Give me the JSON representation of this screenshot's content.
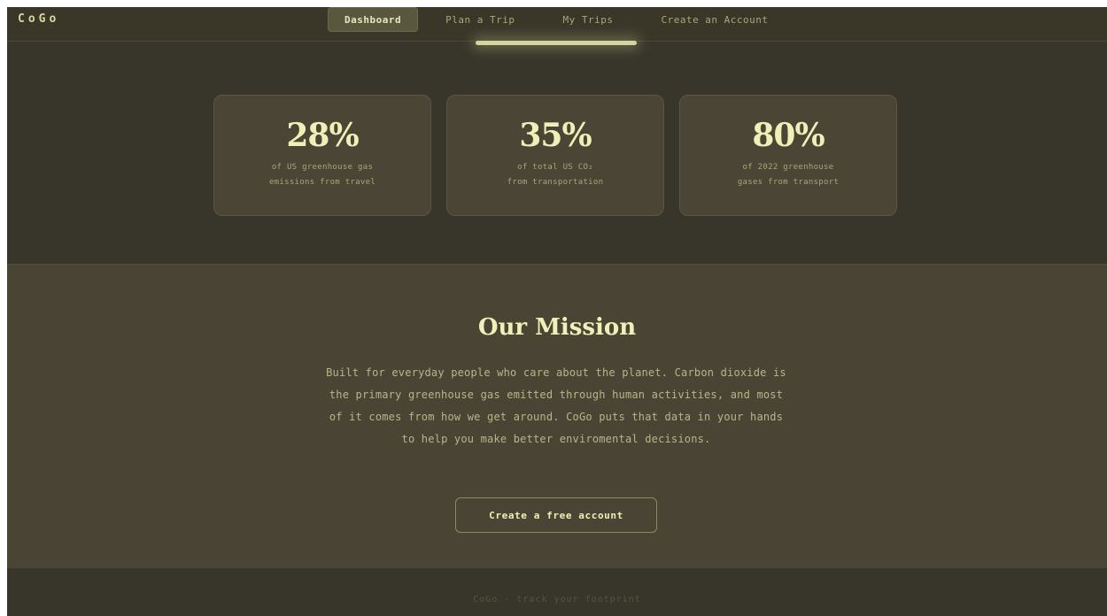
{
  "brand": "CoGo",
  "nav": {
    "items": [
      {
        "label": "Dashboard",
        "active": true
      },
      {
        "label": "Plan a Trip",
        "active": false
      },
      {
        "label": "My Trips",
        "active": false
      },
      {
        "label": "Create an Account",
        "active": false
      }
    ]
  },
  "stats": [
    {
      "value": "28%",
      "desc": "of US greenhouse gas\nemissions from travel"
    },
    {
      "value": "35%",
      "desc": "of total US CO₂\nfrom transportation"
    },
    {
      "value": "80%",
      "desc": "of 2022 greenhouse\ngases from transport"
    }
  ],
  "mission": {
    "title": "Our Mission",
    "body": "Built for everyday people who care about the planet. Carbon dioxide is the primary greenhouse gas emitted through human activities, and most of it comes from how we get around. CoGo puts that data in your hands to help you make better enviromental decisions.",
    "cta": "Create a free account"
  },
  "footer": {
    "text": "CoGo · track your footprint"
  },
  "colors": {
    "background": "#38362a",
    "panel": "#4a4534",
    "accent": "#eef0b8",
    "muted": "#a9a67a"
  }
}
